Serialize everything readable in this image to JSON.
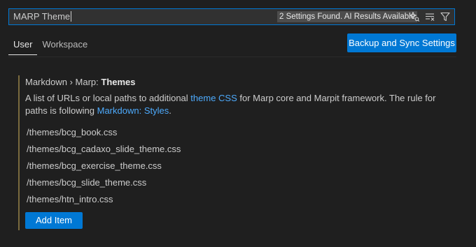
{
  "search": {
    "value": "MARP Theme",
    "results_badge": "2 Settings Found. AI Results Available",
    "icons": [
      "sparkle-search-icon",
      "clear-filter-icon",
      "filter-icon"
    ]
  },
  "tabs": [
    {
      "label": "User",
      "active": true
    },
    {
      "label": "Workspace",
      "active": false
    }
  ],
  "sync_button": {
    "label": "Backup and Sync Settings"
  },
  "setting": {
    "category": "Markdown › Marp: ",
    "name": "Themes",
    "description": {
      "part1": "A list of URLs or local paths to additional ",
      "link1": "theme CSS",
      "part2": " for Marp core and Marpit framework. The rule for paths is following ",
      "link2": "Markdown: Styles",
      "part3": "."
    },
    "items": [
      "/themes/bcg_book.css",
      "/themes/bcg_cadaxo_slide_theme.css",
      "/themes/bcg_exercise_theme.css",
      "/themes/bcg_slide_theme.css",
      "/themes/htn_intro.css"
    ],
    "add_button": "Add Item"
  },
  "colors": {
    "background": "#1f1f1f",
    "accent": "#0078d4",
    "link": "#4daafc",
    "modified_indicator": "#7a6a3e"
  }
}
